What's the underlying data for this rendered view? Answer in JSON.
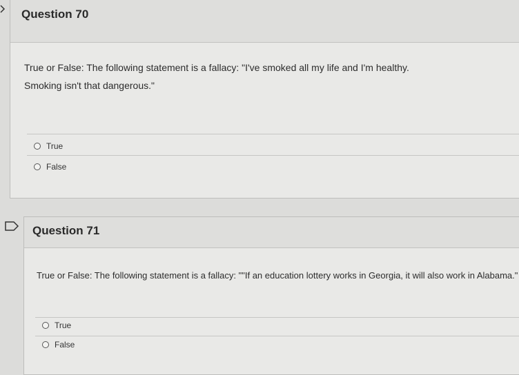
{
  "questions": [
    {
      "title": "Question 70",
      "text": "True or False: The following statement is a fallacy: \"I've smoked all my life and I'm healthy. Smoking isn't that dangerous.\"",
      "options": [
        "True",
        "False"
      ]
    },
    {
      "title": "Question 71",
      "text": "True or False: The following statement is a fallacy: \"\"If an education lottery works in Georgia, it will also work in Alabama.\"",
      "options": [
        "True",
        "False"
      ]
    }
  ],
  "colors": {
    "background": "#dcdcda",
    "card": "#e9e9e7",
    "header": "#dededc"
  }
}
